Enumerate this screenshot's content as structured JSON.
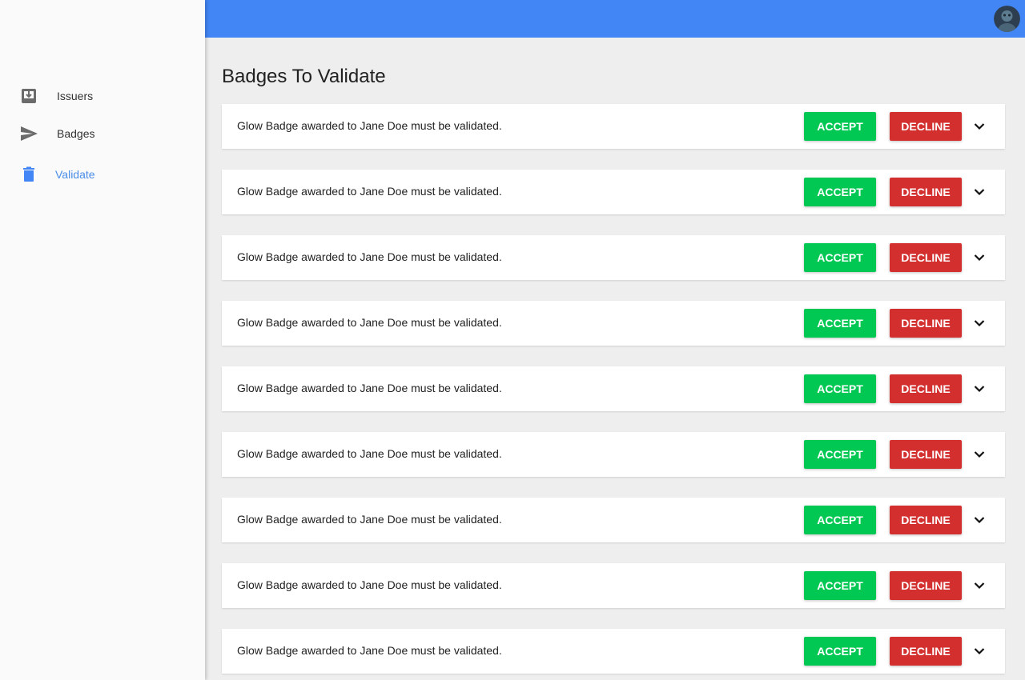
{
  "sidebar": {
    "items": [
      {
        "label": "Issuers",
        "icon": "inbox-download-icon",
        "active": false
      },
      {
        "label": "Badges",
        "icon": "send-icon",
        "active": false
      },
      {
        "label": "Validate",
        "icon": "trash-icon",
        "active": true
      }
    ]
  },
  "colors": {
    "topbar": "#4285f4",
    "accept": "#00c853",
    "decline": "#d32f2f",
    "active_nav": "#4a8de8"
  },
  "main": {
    "title": "Badges To Validate",
    "cards": [
      {
        "text": "Glow Badge awarded to Jane Doe must be validated.",
        "accept_label": "ACCEPT",
        "decline_label": "DECLINE"
      },
      {
        "text": "Glow Badge awarded to Jane Doe must be validated.",
        "accept_label": "ACCEPT",
        "decline_label": "DECLINE"
      },
      {
        "text": "Glow Badge awarded to Jane Doe must be validated.",
        "accept_label": "ACCEPT",
        "decline_label": "DECLINE"
      },
      {
        "text": "Glow Badge awarded to Jane Doe must be validated.",
        "accept_label": "ACCEPT",
        "decline_label": "DECLINE"
      },
      {
        "text": "Glow Badge awarded to Jane Doe must be validated.",
        "accept_label": "ACCEPT",
        "decline_label": "DECLINE"
      },
      {
        "text": "Glow Badge awarded to Jane Doe must be validated.",
        "accept_label": "ACCEPT",
        "decline_label": "DECLINE"
      },
      {
        "text": "Glow Badge awarded to Jane Doe must be validated.",
        "accept_label": "ACCEPT",
        "decline_label": "DECLINE"
      },
      {
        "text": "Glow Badge awarded to Jane Doe must be validated.",
        "accept_label": "ACCEPT",
        "decline_label": "DECLINE"
      },
      {
        "text": "Glow Badge awarded to Jane Doe must be validated.",
        "accept_label": "ACCEPT",
        "decline_label": "DECLINE"
      }
    ]
  }
}
